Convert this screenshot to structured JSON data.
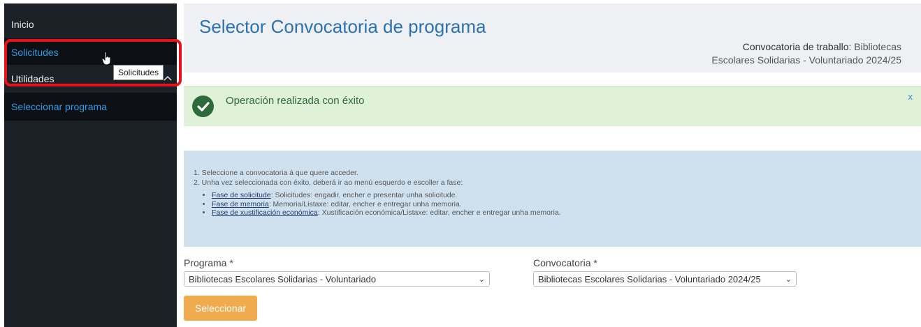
{
  "sidebar": {
    "items": [
      {
        "label": "Inicio"
      },
      {
        "label": "Solicitudes"
      },
      {
        "label": "Utilidades"
      },
      {
        "label": "Seleccionar programa"
      }
    ],
    "tooltip": "Solicitudes"
  },
  "header": {
    "title": "Selector Convocatoria de programa",
    "conv_label": "Convocatoria de traballo:",
    "conv_value_1": "Bibliotecas",
    "conv_value_2": "Escolares Solidarias - Voluntariado 2024/25"
  },
  "alert": {
    "message": "Operación realizada con éxito",
    "close": "x"
  },
  "info": {
    "line1": "1. Seleccione a convocatoria á que quere acceder.",
    "line2": "2. Unha vez seleccionada con éxito, deberá ir ao menú esquerdo e escoller a fase:",
    "phases": [
      {
        "name": "Fase de solicitude",
        "desc": ": Solicitudes: engadir,  encher e presentar unha solicitude."
      },
      {
        "name": "Fase de memoria",
        "desc": ": Memoria/Listaxe: editar, encher e entregar unha memoria."
      },
      {
        "name": "Fase de xustificación económica",
        "desc": ": Xustificación económica/Listaxe: editar, encher e entregar unha memoria."
      }
    ]
  },
  "form": {
    "programa_label": "Programa *",
    "programa_value": "Bibliotecas Escolares Solidarias - Voluntariado",
    "convocatoria_label": "Convocatoria *",
    "convocatoria_value": "Bibliotecas Escolares Solidarias - Voluntariado 2024/25",
    "button": "Seleccionar"
  },
  "colors": {
    "sidebar_bg": "#1b2127",
    "accent_blue": "#2f9be8",
    "highlight_red": "#e8121b",
    "success_bg": "#dff1d9",
    "info_bg": "#cfe1ef",
    "button_orange": "#f0ab4f"
  }
}
